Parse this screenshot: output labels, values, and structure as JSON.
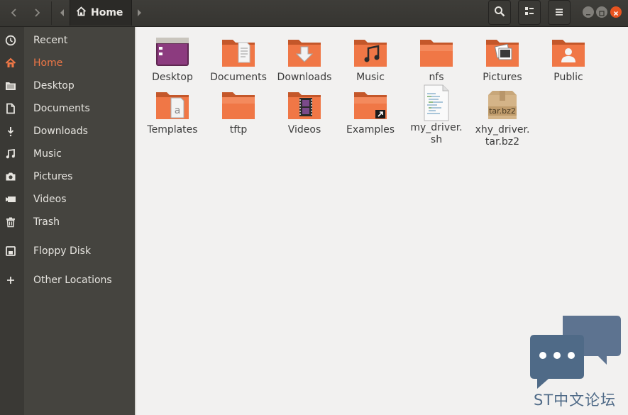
{
  "header": {
    "current_location": "Home",
    "icons": {
      "back": "chevron-left-icon",
      "forward": "chevron-right-icon",
      "search": "search-icon",
      "view": "list-view-icon",
      "menu": "hamburger-menu-icon"
    }
  },
  "sidebar": {
    "items": [
      {
        "label": "Recent",
        "icon": "clock-icon",
        "active": false
      },
      {
        "label": "Home",
        "icon": "home-icon",
        "active": true
      },
      {
        "label": "Desktop",
        "icon": "folder-icon",
        "active": false
      },
      {
        "label": "Documents",
        "icon": "document-icon",
        "active": false
      },
      {
        "label": "Downloads",
        "icon": "download-icon",
        "active": false
      },
      {
        "label": "Music",
        "icon": "music-icon",
        "active": false
      },
      {
        "label": "Pictures",
        "icon": "camera-icon",
        "active": false
      },
      {
        "label": "Videos",
        "icon": "video-icon",
        "active": false
      },
      {
        "label": "Trash",
        "icon": "trash-icon",
        "active": false
      },
      {
        "label": "Floppy Disk",
        "icon": "floppy-icon",
        "active": false
      },
      {
        "label": "Other Locations",
        "icon": "plus-icon",
        "active": false
      }
    ]
  },
  "files": [
    {
      "name": "Desktop",
      "kind": "desktop-folder"
    },
    {
      "name": "Documents",
      "kind": "documents-folder"
    },
    {
      "name": "Downloads",
      "kind": "downloads-folder"
    },
    {
      "name": "Music",
      "kind": "music-folder"
    },
    {
      "name": "nfs",
      "kind": "folder"
    },
    {
      "name": "Pictures",
      "kind": "pictures-folder"
    },
    {
      "name": "Public",
      "kind": "public-folder"
    },
    {
      "name": "Templates",
      "kind": "templates-folder"
    },
    {
      "name": "tftp",
      "kind": "folder"
    },
    {
      "name": "Videos",
      "kind": "videos-folder"
    },
    {
      "name": "Examples",
      "kind": "link-folder"
    },
    {
      "name": "my_driver.\nsh",
      "kind": "script-file"
    },
    {
      "name": "xhy_driver.\ntar.bz2",
      "kind": "archive-file",
      "badge": "tar.bz2"
    }
  ],
  "watermark": {
    "text": "ST中文论坛"
  },
  "colors": {
    "accent": "#e95420",
    "folder": "#f07746",
    "sidebar": "#45443f",
    "header": "#3a3935"
  }
}
